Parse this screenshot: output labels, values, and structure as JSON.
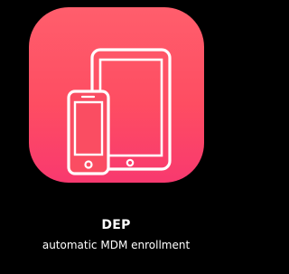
{
  "app": {
    "title": "DEP",
    "subtitle": "automatic MDM enrollment",
    "icon": "devices-icon"
  },
  "colors": {
    "background": "#000000",
    "icon_gradient_top": "#ff5e6c",
    "icon_gradient_bottom": "#f8396f",
    "device_stroke": "#ffffff",
    "text": "#ffffff"
  }
}
